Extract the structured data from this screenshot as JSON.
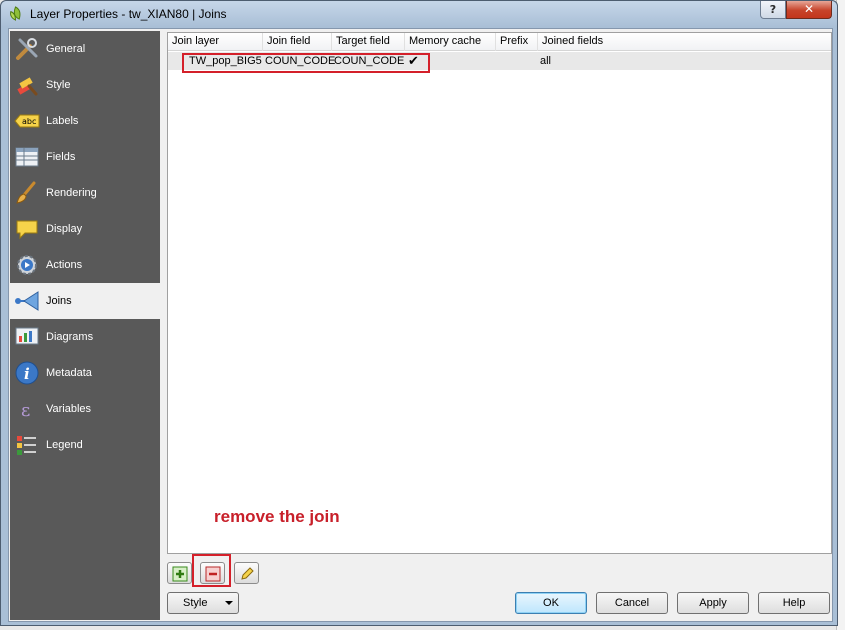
{
  "window": {
    "title": "Layer Properties - tw_XIAN80 | Joins",
    "help_label": "?",
    "close_label": "✕"
  },
  "sidebar": {
    "items": [
      {
        "label": "General",
        "icon": "general-tools-icon"
      },
      {
        "label": "Style",
        "icon": "style-brush-icon"
      },
      {
        "label": "Labels",
        "icon": "labels-abc-icon"
      },
      {
        "label": "Fields",
        "icon": "fields-table-icon"
      },
      {
        "label": "Rendering",
        "icon": "rendering-brush-icon"
      },
      {
        "label": "Display",
        "icon": "display-bubble-icon"
      },
      {
        "label": "Actions",
        "icon": "actions-gear-icon"
      },
      {
        "label": "Joins",
        "icon": "joins-icon"
      },
      {
        "label": "Diagrams",
        "icon": "diagrams-chart-icon"
      },
      {
        "label": "Metadata",
        "icon": "metadata-info-icon"
      },
      {
        "label": "Variables",
        "icon": "variables-epsilon-icon"
      },
      {
        "label": "Legend",
        "icon": "legend-icon"
      }
    ],
    "active": "Joins"
  },
  "joins_table": {
    "columns": [
      "Join layer",
      "Join field",
      "Target field",
      "Memory cache",
      "Prefix",
      "Joined fields"
    ],
    "rows": [
      {
        "join_layer": "TW_pop_BIG5",
        "join_field": "COUN_CODE",
        "target_field": "COUN_CODE",
        "memory_cache": "✔",
        "prefix": "",
        "joined_fields": "all"
      }
    ]
  },
  "annotation": "remove the join",
  "join_buttons": {
    "add": "add-join-icon",
    "remove": "remove-join-icon",
    "edit": "edit-join-icon"
  },
  "buttons": {
    "style": "Style",
    "ok": "OK",
    "cancel": "Cancel",
    "apply": "Apply",
    "help": "Help"
  },
  "colors": {
    "highlight": "#d4202a",
    "sidebar": "#595959"
  }
}
